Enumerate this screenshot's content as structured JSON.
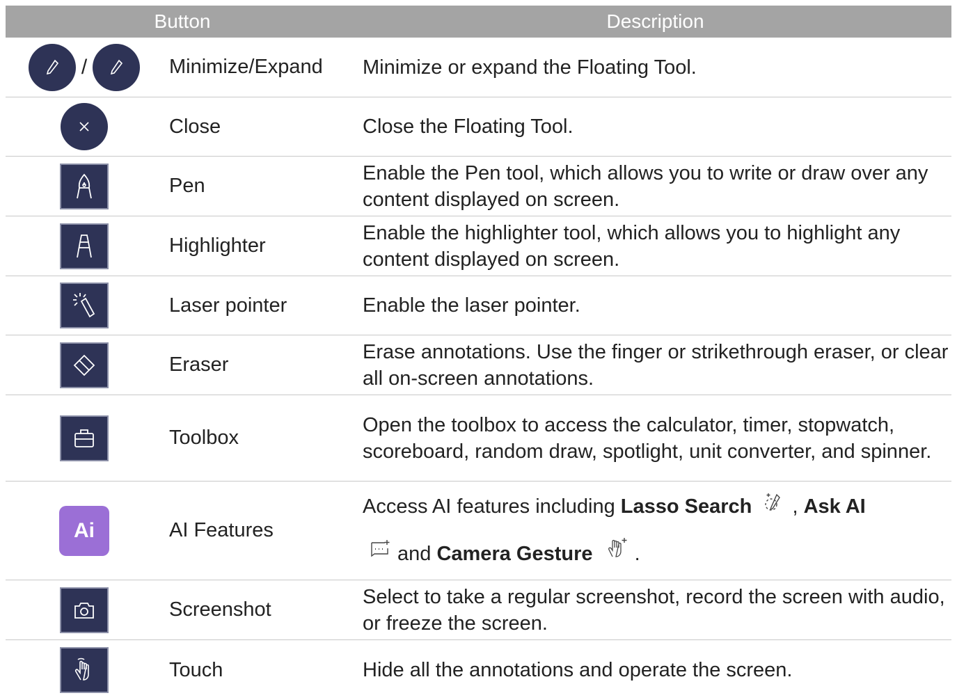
{
  "header": {
    "col_button": "Button",
    "col_description": "Description"
  },
  "rows": [
    {
      "name": "Minimize/Expand",
      "separator": "/",
      "description": "Minimize or expand the Floating Tool."
    },
    {
      "name": "Close",
      "description": "Close the Floating Tool."
    },
    {
      "name": "Pen",
      "description": "Enable the Pen tool, which allows you to write or draw over any content displayed on screen."
    },
    {
      "name": "Highlighter",
      "description": "Enable the highlighter tool, which allows you to highlight any content displayed on screen."
    },
    {
      "name": "Laser pointer",
      "description": "Enable the laser pointer."
    },
    {
      "name": "Eraser",
      "description": "Erase annotations. Use the finger or strikethrough eraser, or clear all on-screen annotations."
    },
    {
      "name": "Toolbox",
      "description": "Open the toolbox to access the calculator, timer, stopwatch, scoreboard, random draw, spotlight, unit converter, and spinner."
    },
    {
      "name": "AI Features",
      "icon_text": "Ai",
      "desc_parts": {
        "p1": "Access AI features including ",
        "b1": "Lasso Search",
        "sep": ",",
        "b2": "Ask AI",
        "p2": "and",
        "b3": "Camera Gesture",
        "end": "."
      }
    },
    {
      "name": "Screenshot",
      "description": "Select to take a regular screenshot, record the screen with audio, or freeze the screen."
    },
    {
      "name": "Touch",
      "description": "Hide all the annotations and operate the screen."
    }
  ],
  "colors": {
    "icon_bg": "#2e3356",
    "ai_bg": "#9b6fd6",
    "header_bg": "#a4a4a4"
  }
}
